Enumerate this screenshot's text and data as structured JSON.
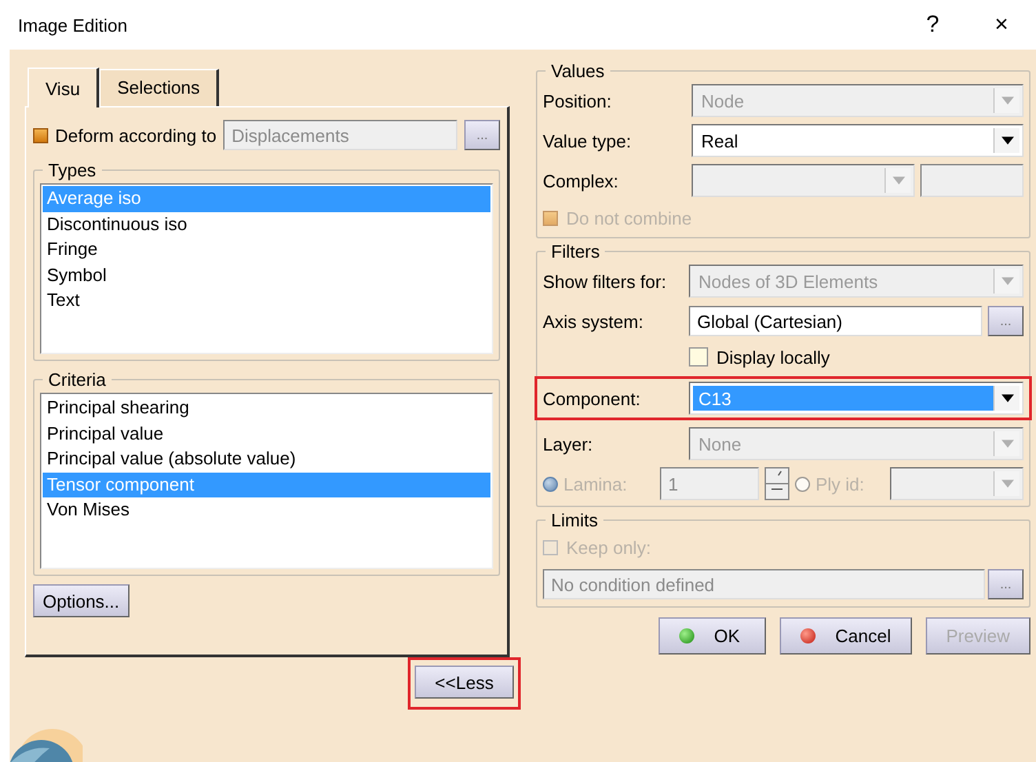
{
  "window": {
    "title": "Image Edition",
    "help": "?",
    "close": "×"
  },
  "tabs": [
    {
      "label": "Visu",
      "selected": true
    },
    {
      "label": "Selections",
      "selected": false
    }
  ],
  "deform": {
    "label": "Deform according to",
    "checked": true,
    "value": "Displacements",
    "browse": "..."
  },
  "types": {
    "title": "Types",
    "items": [
      {
        "label": "Average iso",
        "selected": true
      },
      {
        "label": "Discontinuous iso",
        "selected": false
      },
      {
        "label": "Fringe",
        "selected": false
      },
      {
        "label": "Symbol",
        "selected": false
      },
      {
        "label": "Text",
        "selected": false
      }
    ]
  },
  "criteria": {
    "title": "Criteria",
    "items": [
      {
        "label": "Principal shearing",
        "selected": false
      },
      {
        "label": "Principal value",
        "selected": false
      },
      {
        "label": "Principal value (absolute value)",
        "selected": false
      },
      {
        "label": "Tensor component",
        "selected": true
      },
      {
        "label": "Von Mises",
        "selected": false
      }
    ]
  },
  "options_button": "Options...",
  "less_button": {
    "label": "<<Less",
    "highlighted": true
  },
  "values": {
    "title": "Values",
    "rows": [
      {
        "kind": "combo",
        "label": "Position:",
        "value": "Node",
        "disabled": true,
        "selected": false
      },
      {
        "kind": "combo",
        "label": "Value type:",
        "value": "Real",
        "disabled": false,
        "selected": false
      },
      {
        "kind": "complex",
        "label": "Complex:",
        "disabled": true
      },
      {
        "kind": "check",
        "label": "Do not combine",
        "checked": true,
        "disabled": true
      }
    ]
  },
  "filters": {
    "title": "Filters",
    "rows": [
      {
        "kind": "combo",
        "label": "Show filters for:",
        "value": "Nodes of 3D Elements",
        "disabled": true,
        "selected": false
      },
      {
        "kind": "browse",
        "label": "Axis system:",
        "value": "Global (Cartesian)",
        "browse": "..."
      },
      {
        "kind": "indented-check",
        "label": "Display locally",
        "checked": false,
        "disabled": false
      },
      {
        "kind": "combo",
        "label": "Component:",
        "value": "C13",
        "disabled": false,
        "selected": true,
        "highlighted": true
      },
      {
        "kind": "combo",
        "label": "Layer:",
        "value": "None",
        "disabled": true,
        "selected": false
      },
      {
        "kind": "lamina",
        "lamina_label": "Lamina:",
        "lamina_selected": true,
        "spin_value": "1",
        "ply_label": "Ply id:",
        "ply_selected": false,
        "disabled": true
      }
    ]
  },
  "limits": {
    "title": "Limits",
    "keep_only": {
      "label": "Keep only:",
      "checked": false,
      "disabled": true
    },
    "condition": "No condition defined",
    "browse": "..."
  },
  "footer_buttons": [
    {
      "kind": "ok",
      "label": "OK",
      "disabled": false
    },
    {
      "kind": "cancel",
      "label": "Cancel",
      "disabled": false
    },
    {
      "kind": "plain",
      "label": "Preview",
      "disabled": true
    }
  ]
}
